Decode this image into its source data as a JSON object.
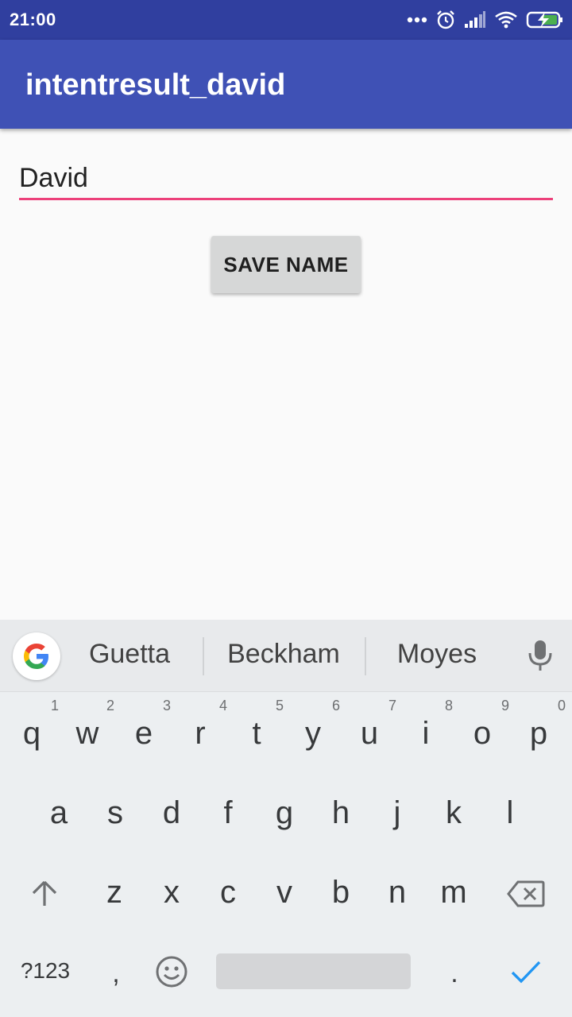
{
  "status_bar": {
    "time": "21:00"
  },
  "app_bar": {
    "title": "intentresult_david"
  },
  "form": {
    "name_value": "David",
    "save_button_label": "SAVE NAME"
  },
  "colors": {
    "status_bar": "#303f9f",
    "app_bar": "#3f51b5",
    "input_underline": "#ec407a",
    "button": "#d6d7d7",
    "keyboard_bg": "#eceff1",
    "enter_check": "#2196f3"
  },
  "keyboard": {
    "suggestions": [
      "Guetta",
      "Beckham",
      "Moyes"
    ],
    "row1": [
      {
        "k": "q",
        "n": "1"
      },
      {
        "k": "w",
        "n": "2"
      },
      {
        "k": "e",
        "n": "3"
      },
      {
        "k": "r",
        "n": "4"
      },
      {
        "k": "t",
        "n": "5"
      },
      {
        "k": "y",
        "n": "6"
      },
      {
        "k": "u",
        "n": "7"
      },
      {
        "k": "i",
        "n": "8"
      },
      {
        "k": "o",
        "n": "9"
      },
      {
        "k": "p",
        "n": "0"
      }
    ],
    "row2": [
      "a",
      "s",
      "d",
      "f",
      "g",
      "h",
      "j",
      "k",
      "l"
    ],
    "row3": [
      "z",
      "x",
      "c",
      "v",
      "b",
      "n",
      "m"
    ],
    "symbols_label": "?123",
    "comma": ",",
    "period": ".",
    "icons": [
      "google-g-icon",
      "mic-icon",
      "shift-icon",
      "backspace-icon",
      "emoji-icon",
      "check-icon"
    ]
  }
}
